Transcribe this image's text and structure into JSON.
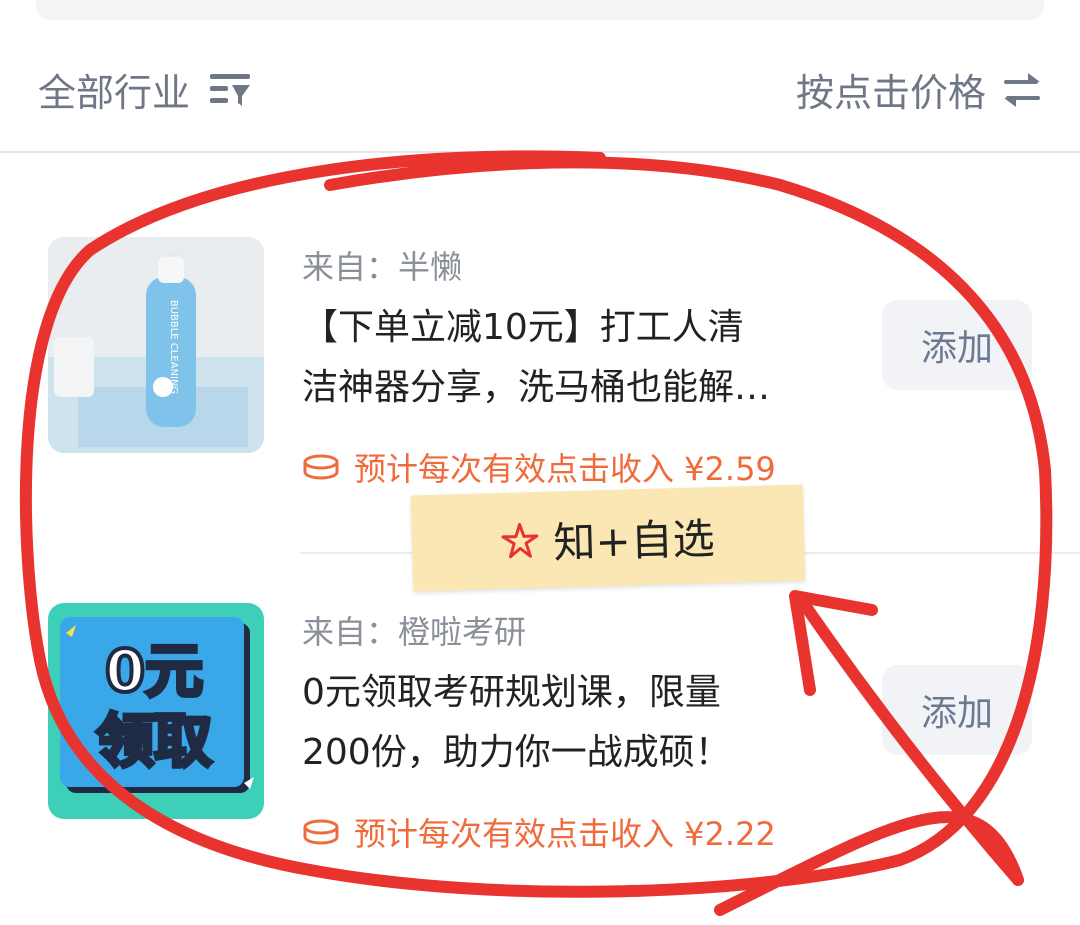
{
  "filter": {
    "category_label": "全部行业",
    "sort_label": "按点击价格"
  },
  "items": [
    {
      "source": "来自：半懒",
      "title_line1": "【下单立减10元】打工人清",
      "title_line2": "洁神器分享，洗马桶也能解…",
      "earn": "预计每次有效点击收入 ¥2.59",
      "add_label": "添加",
      "thumb_text": "BUBBLE CLEANING"
    },
    {
      "source": "来自：橙啦考研",
      "title_line1": "0元领取考研规划课，限量",
      "title_line2": "200份，助力你一战成硕！",
      "earn": "预计每次有效点击收入 ¥2.22",
      "add_label": "添加",
      "thumb_line1": "0元",
      "thumb_line2": "领取"
    }
  ],
  "sticker": {
    "text": "知+自选"
  },
  "colors": {
    "accent": "#f06b3b",
    "annotation": "#e8332f",
    "muted": "#6f7787"
  }
}
